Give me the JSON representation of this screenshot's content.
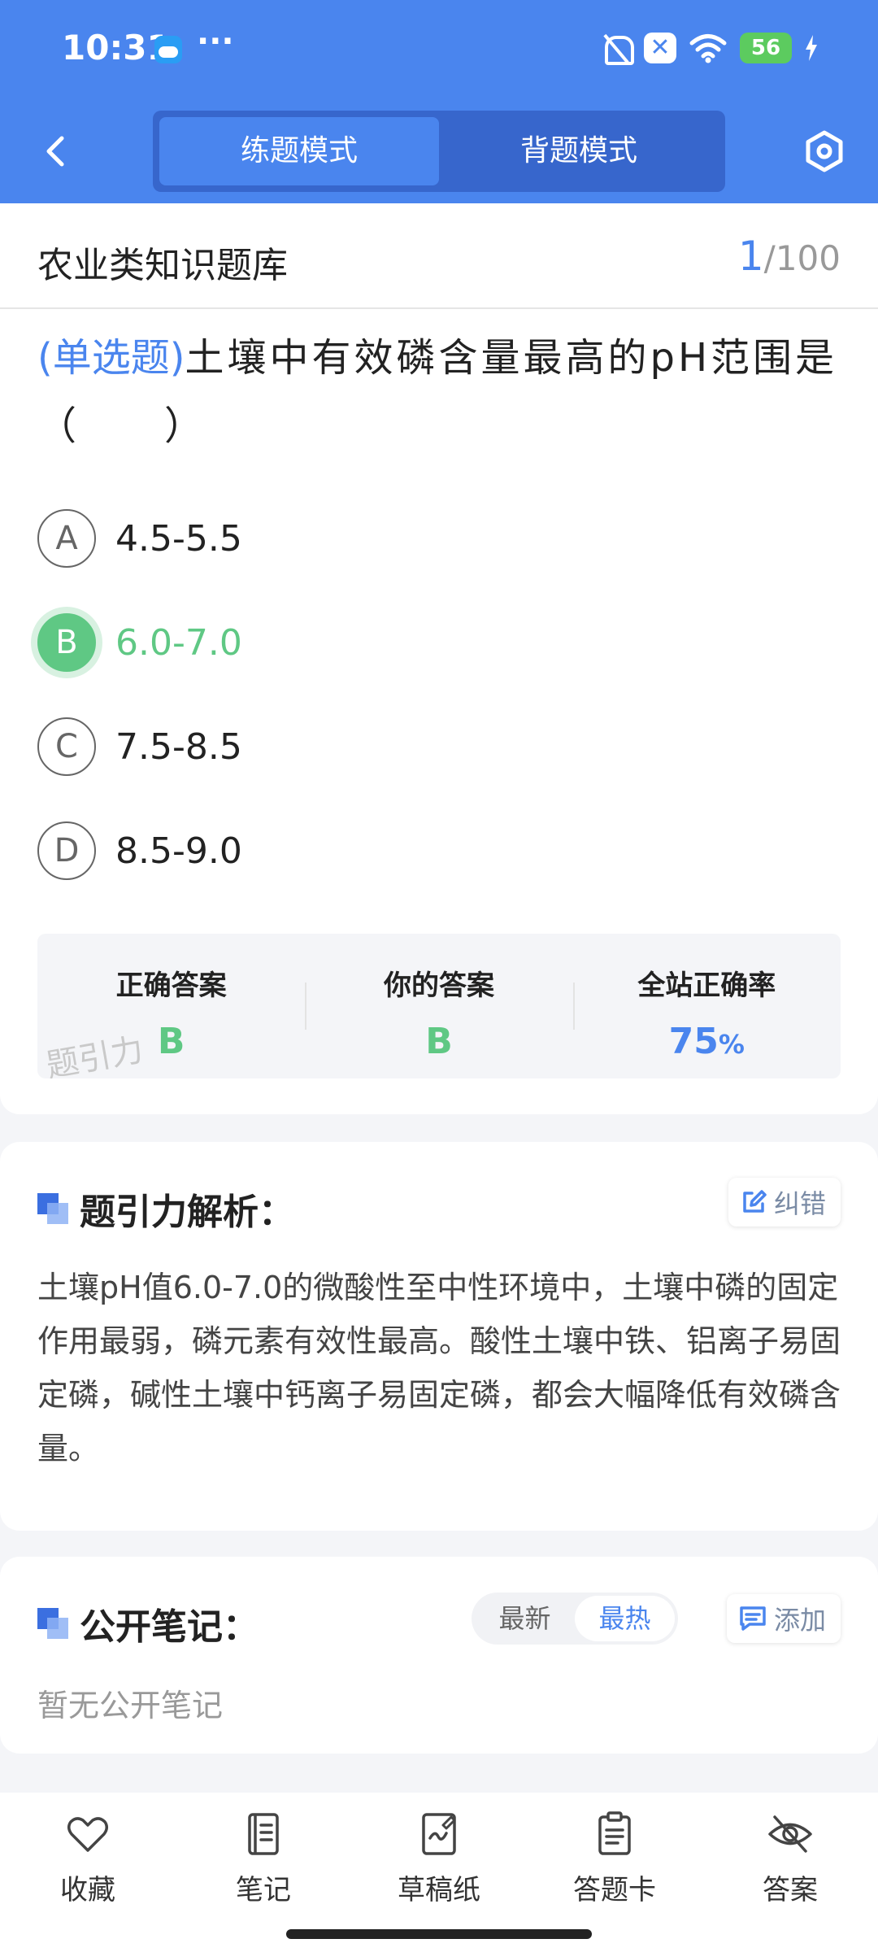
{
  "status_bar": {
    "time": "10:31",
    "dots": "···",
    "close_badge": "✕",
    "battery": "56"
  },
  "nav": {
    "tabs": [
      "练题模式",
      "背题模式"
    ],
    "active_tab": "练题模式"
  },
  "bank": {
    "title": "农业类知识题库",
    "current": "1",
    "total": "/100"
  },
  "question": {
    "type_label": "(单选题)",
    "text": "土壤中有效磷含量最高的pH范围是（　　）",
    "options": [
      {
        "letter": "A",
        "text": "4.5-5.5"
      },
      {
        "letter": "B",
        "text": "6.0-7.0"
      },
      {
        "letter": "C",
        "text": "7.5-8.5"
      },
      {
        "letter": "D",
        "text": "8.5-9.0"
      }
    ],
    "selected": "B"
  },
  "answer_stats": {
    "correct_label": "正确答案",
    "correct_value": "B",
    "yours_label": "你的答案",
    "yours_value": "B",
    "rate_label": "全站正确率",
    "rate_value": "75",
    "rate_unit": "%",
    "watermark": "题引力"
  },
  "analysis": {
    "title": "题引力解析：",
    "correct_button": "纠错",
    "text": "土壤pH值6.0-7.0的微酸性至中性环境中，土壤中磷的固定作用最弱，磷元素有效性最高。酸性土壤中铁、铝离子易固定磷，碱性土壤中钙离子易固定磷，都会大幅降低有效磷含量。"
  },
  "notes": {
    "title": "公开笔记：",
    "sort_options": [
      "最新",
      "最热"
    ],
    "active_sort": "最热",
    "add_button": "添加",
    "empty_text": "暂无公开笔记"
  },
  "bottom_bar": [
    {
      "icon": "heart-icon",
      "label": "收藏"
    },
    {
      "icon": "notebook-icon",
      "label": "笔记"
    },
    {
      "icon": "draft-paper-icon",
      "label": "草稿纸"
    },
    {
      "icon": "answer-sheet-icon",
      "label": "答题卡"
    },
    {
      "icon": "eye-off-icon",
      "label": "答案"
    }
  ],
  "colors": {
    "primary": "#4a85ee",
    "correct_green": "#5fc884"
  }
}
